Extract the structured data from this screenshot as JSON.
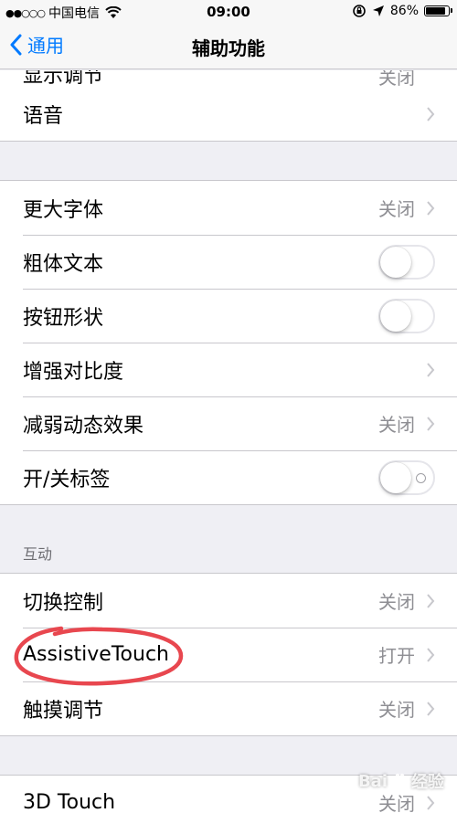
{
  "status_bar": {
    "signal_dots": "●●○○○",
    "carrier": "中国电信",
    "time": "09:00",
    "battery_percent": "86%",
    "battery_level": 0.86
  },
  "nav": {
    "back_label": "通用",
    "title": "辅助功能"
  },
  "partial_top": {
    "label": "显示调节",
    "value": "关闭"
  },
  "group1": [
    {
      "label": "语音"
    }
  ],
  "group2": [
    {
      "label": "更大字体",
      "value": "关闭"
    },
    {
      "label": "粗体文本",
      "toggle": false
    },
    {
      "label": "按钮形状",
      "toggle": false
    },
    {
      "label": "增强对比度"
    },
    {
      "label": "减弱动态效果",
      "value": "关闭"
    },
    {
      "label": "开/关标签",
      "toggle": false
    }
  ],
  "section_interaction": {
    "header": "互动",
    "rows": [
      {
        "label": "切换控制",
        "value": "关闭"
      },
      {
        "label": "AssistiveTouch",
        "value": "打开"
      },
      {
        "label": "触摸调节",
        "value": "关闭"
      }
    ]
  },
  "group4": [
    {
      "label": "3D Touch",
      "value": "关闭"
    }
  ],
  "colors": {
    "accent": "#007aff",
    "annotation": "#e8474f",
    "background": "#efeff4"
  },
  "watermark": {
    "left": "Bai",
    "right": "经验"
  }
}
